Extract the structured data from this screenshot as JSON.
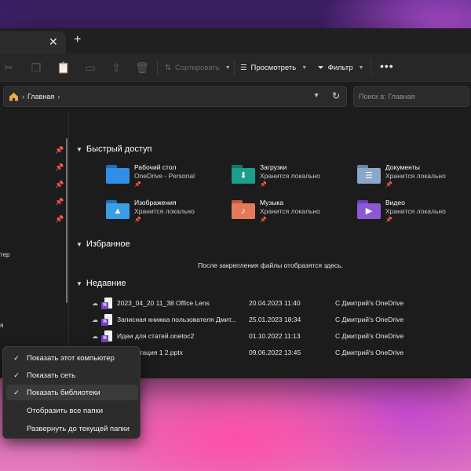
{
  "tabs": {
    "close_glyph": "✕",
    "new_glyph": "+"
  },
  "toolbar": {
    "sort_label": "Сортировать",
    "view_label": "Просмотреть",
    "filter_label": "Фильтр",
    "more_glyph": "•••"
  },
  "address": {
    "crumb": "Главная",
    "search_placeholder": "Поиск в: Главная"
  },
  "nav": {
    "fragments": [
      "тер",
      "я"
    ]
  },
  "quick_access": {
    "title": "Быстрый доступ",
    "items": [
      {
        "name": "Рабочий стол",
        "sub": "OneDrive - Personal",
        "icon": "desktop-folder-icon",
        "color": "#2f8fe6"
      },
      {
        "name": "Загрузки",
        "sub": "Хранится локально",
        "icon": "downloads-folder-icon",
        "color": "#1b9e8a"
      },
      {
        "name": "Документы",
        "sub": "Хранится локально",
        "icon": "documents-folder-icon",
        "color": "#8aa6c9"
      },
      {
        "name": "Изображения",
        "sub": "Хранится локально",
        "icon": "pictures-folder-icon",
        "color": "#3a9ee4"
      },
      {
        "name": "Музыка",
        "sub": "Хранится локально",
        "icon": "music-folder-icon",
        "color": "#e8785a"
      },
      {
        "name": "Видео",
        "sub": "Хранится локально",
        "icon": "videos-folder-icon",
        "color": "#8a5ad6"
      }
    ]
  },
  "favorites": {
    "title": "Избранное",
    "empty_message": "После закрепления файлы отобразятся здесь."
  },
  "recent": {
    "title": "Недавние",
    "items": [
      {
        "name": "2023_04_20 11_38 Office Lens",
        "date": "20.04.2023 11:40",
        "location": "С Дмитрий's OneDrive",
        "type": "onenote"
      },
      {
        "name": "Записная книжка пользователя Дмит...",
        "date": "25.01.2023 18:34",
        "location": "С Дмитрий's OneDrive",
        "type": "onenote"
      },
      {
        "name": "Идеи для статей.onetoc2",
        "date": "01.10.2022 11:13",
        "location": "С Дмитрий's OneDrive",
        "type": "onenote"
      },
      {
        "name": "Презентация 1 2.pptx",
        "date": "09.06.2022 13:45",
        "location": "С Дмитрий's OneDrive",
        "type": "powerpoint"
      }
    ]
  },
  "context_menu": {
    "items": [
      {
        "label": "Показать этот компьютер",
        "checked": true,
        "highlighted": false
      },
      {
        "label": "Показать сеть",
        "checked": true,
        "highlighted": false
      },
      {
        "label": "Показать библиотеки",
        "checked": true,
        "highlighted": true
      },
      {
        "label": "Отобразить все папки",
        "checked": false,
        "highlighted": false
      },
      {
        "label": "Развернуть до текущей папки",
        "checked": false,
        "highlighted": false
      }
    ]
  },
  "colors": {
    "onenote": "#7b3fc4",
    "powerpoint": "#d24726"
  }
}
